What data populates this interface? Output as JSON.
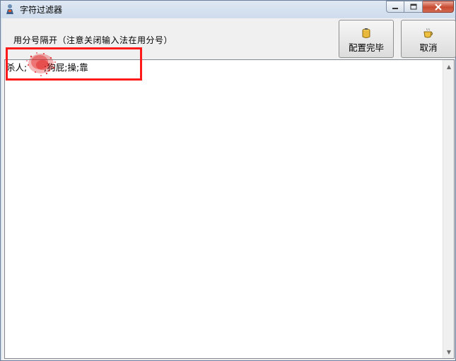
{
  "window": {
    "title": "字符过滤器",
    "icons": {
      "app": "app-person-icon",
      "minimize": "minimize-icon",
      "maximize": "maximize-icon",
      "close": "close-icon"
    }
  },
  "toolbar": {
    "hint": "用分号隔开（注意关闭输入法在用分号）",
    "done_label": "配置完毕",
    "done_icon": "pot-icon",
    "cancel_label": "取消",
    "cancel_icon": "cup-icon"
  },
  "editor": {
    "content": "杀人;      ;狗屁;操;靠"
  },
  "colors": {
    "highlight": "#ff1a1a",
    "close": "#c84a30"
  }
}
